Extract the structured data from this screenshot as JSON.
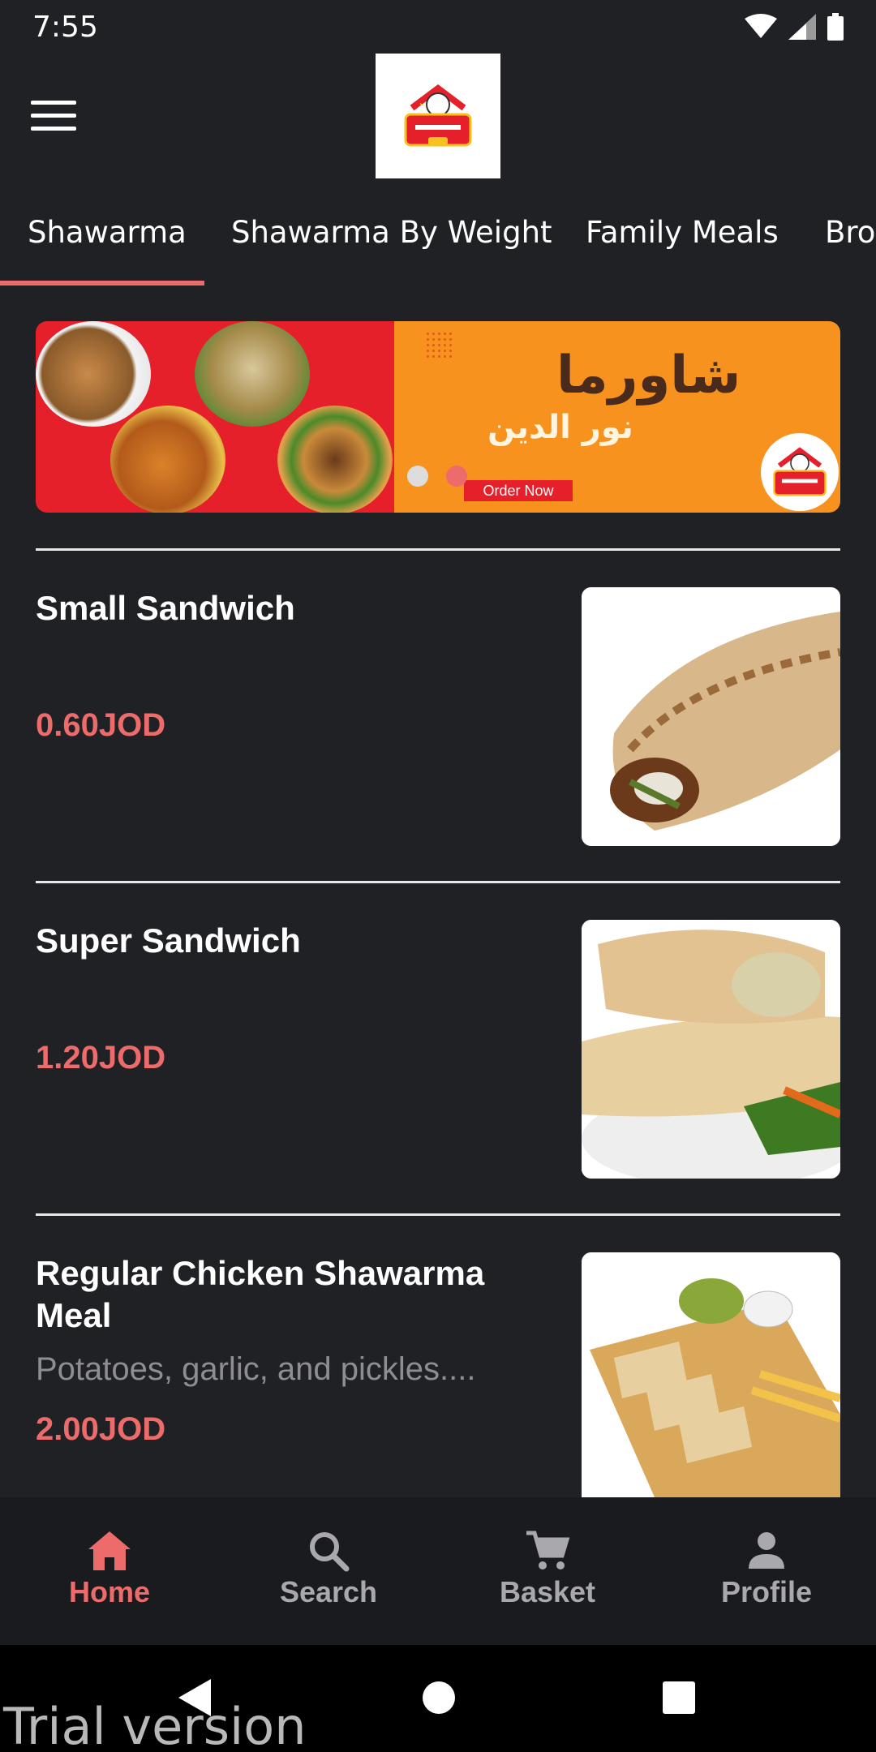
{
  "status_bar": {
    "time": "7:55"
  },
  "tabs": [
    {
      "label": "Shawarma",
      "active": true
    },
    {
      "label": "Shawarma By Weight",
      "active": false
    },
    {
      "label": "Family Meals",
      "active": false
    },
    {
      "label": "Bro",
      "active": false
    }
  ],
  "banner": {
    "title": "شاورما",
    "subtitle": "نور الدين",
    "cta": "Order Now",
    "slide_count": 2,
    "active_slide": 2
  },
  "menu_items": [
    {
      "title": "Small Sandwich",
      "description": "",
      "price": "0.60JOD"
    },
    {
      "title": "Super Sandwich",
      "description": "",
      "price": "1.20JOD"
    },
    {
      "title": "Regular Chicken Shawarma Meal",
      "description": "Potatoes, garlic, and pickles....",
      "price": "2.00JOD"
    }
  ],
  "bottom_nav": [
    {
      "label": "Home",
      "icon": "home-icon",
      "active": true
    },
    {
      "label": "Search",
      "icon": "search-icon",
      "active": false
    },
    {
      "label": "Basket",
      "icon": "cart-icon",
      "active": false
    },
    {
      "label": "Profile",
      "icon": "person-icon",
      "active": false
    }
  ],
  "watermark": "Trial version",
  "colors": {
    "background": "#202125",
    "accent": "#ee6b6b",
    "inactive_nav": "#a9a9ad",
    "banner_red": "#e6202a",
    "banner_orange": "#f7921e"
  }
}
